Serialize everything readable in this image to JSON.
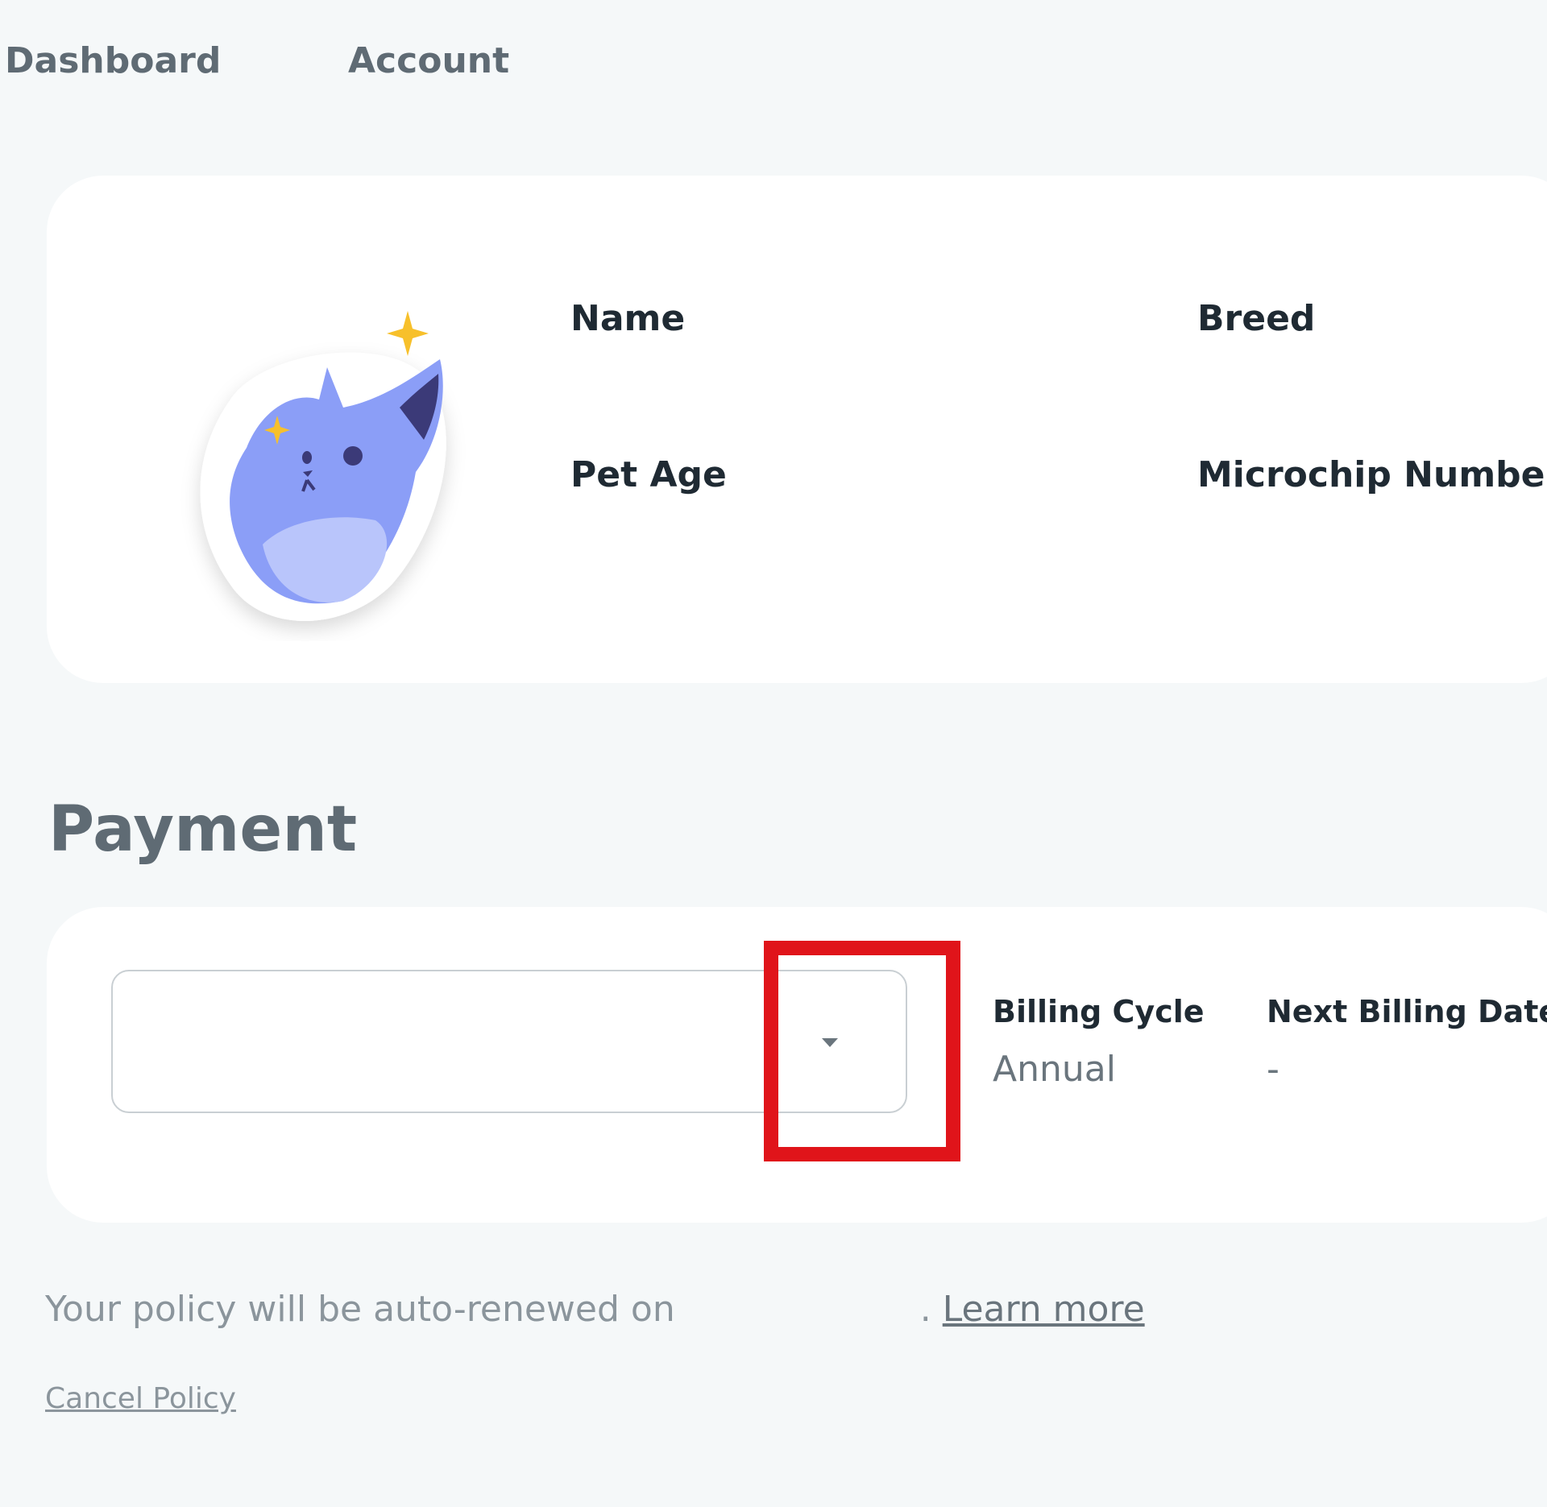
{
  "nav": {
    "items": [
      {
        "label": "Dashboard"
      },
      {
        "label": "Account"
      }
    ]
  },
  "pet": {
    "labels": {
      "name": "Name",
      "breed": "Breed",
      "age": "Pet Age",
      "microchip": "Microchip Number"
    },
    "avatar_icon": "cat-avatar-icon"
  },
  "payment": {
    "title": "Payment",
    "select": {
      "value": "",
      "caret_icon": "chevron-down-icon"
    },
    "billing_cycle": {
      "label": "Billing Cycle",
      "value": "Annual"
    },
    "next_billing_date": {
      "label": "Next Billing Date",
      "value": "-"
    }
  },
  "footer": {
    "renew_text": "Your policy will be auto-renewed on",
    "renew_date": "",
    "period": ".",
    "learn_more": "Learn more",
    "cancel_policy": "Cancel Policy"
  },
  "colors": {
    "background": "#f5f8f9",
    "card": "#ffffff",
    "highlight": "#e0141a",
    "avatar_primary": "#8b9ef7",
    "avatar_dark": "#3b3a78",
    "sparkle": "#f7c02b"
  }
}
